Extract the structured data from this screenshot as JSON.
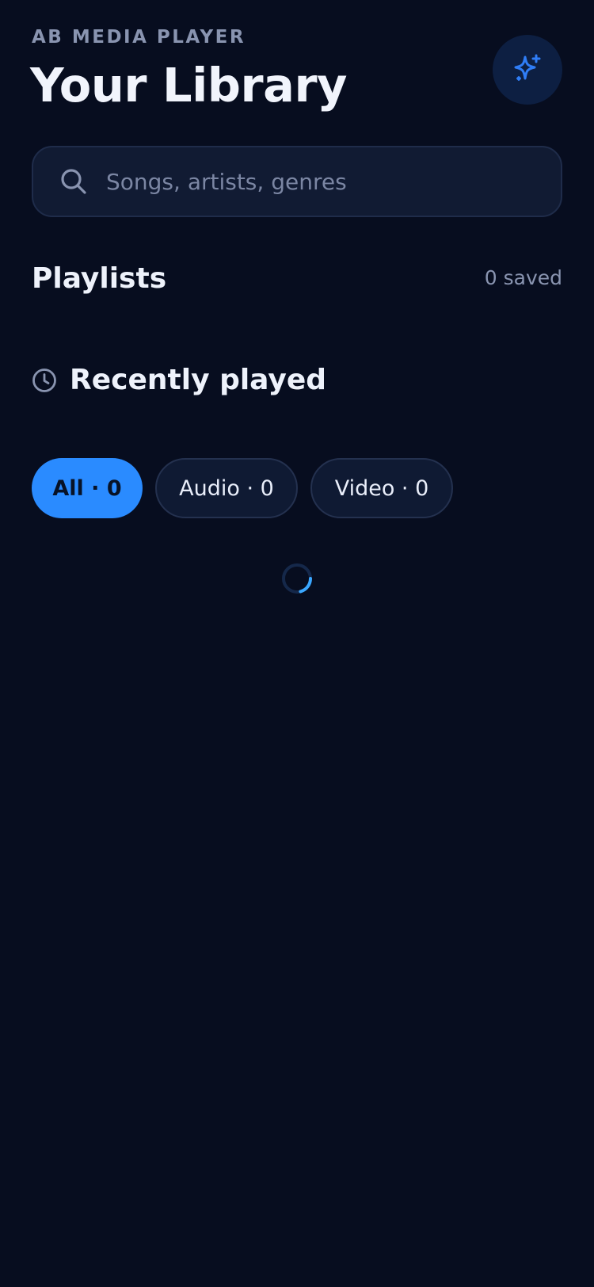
{
  "header": {
    "app_name": "AB MEDIA PLAYER",
    "title": "Your Library",
    "action_icon": "sparkle-icon"
  },
  "search": {
    "placeholder": "Songs, artists, genres",
    "value": "",
    "icon": "search-icon"
  },
  "playlists": {
    "title": "Playlists",
    "saved_label": "0 saved"
  },
  "recent": {
    "icon": "clock-icon",
    "title": "Recently played"
  },
  "filters": [
    {
      "label": "All · 0",
      "active": true
    },
    {
      "label": "Audio · 0",
      "active": false
    },
    {
      "label": "Video · 0",
      "active": false
    }
  ],
  "loading": true,
  "colors": {
    "background": "#070d1f",
    "accent": "#2a8bff",
    "surface": "#111b33",
    "muted_text": "#8994b0",
    "sparkle": "#2f7df6",
    "spinner": "#3aa7ff"
  }
}
